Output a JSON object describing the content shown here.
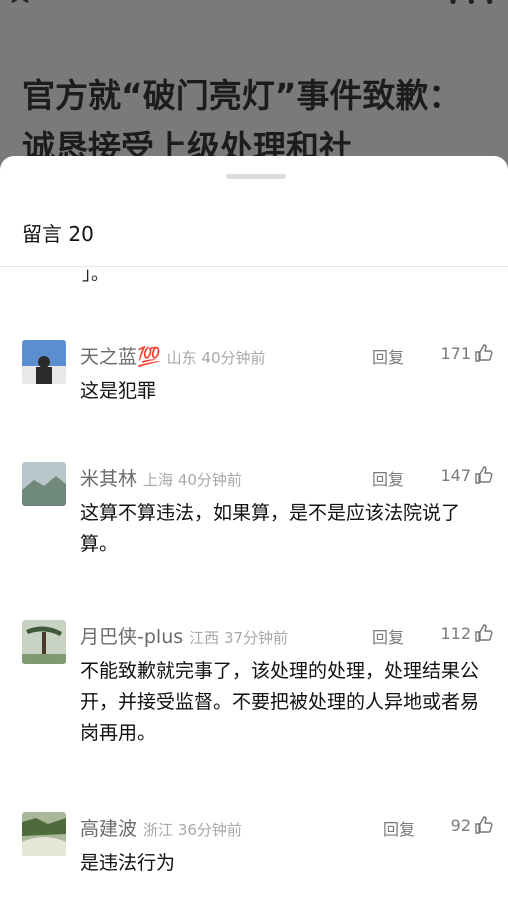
{
  "header": {
    "close_icon": "close-icon",
    "more_icon": "more-icon",
    "more_label": "• • •"
  },
  "article": {
    "title": "官方就“破门亮灯”事件致歉：诚恳接受上级处理和社"
  },
  "sheet": {
    "title": "留言 20",
    "prev_tail": "」。"
  },
  "comments": [
    {
      "name": "天之蓝💯",
      "location": "山东",
      "time": "40分钟前",
      "reply": "回复",
      "likes": "171",
      "text": "这是犯罪"
    },
    {
      "name": "米其林",
      "location": "上海",
      "time": "40分钟前",
      "reply": "回复",
      "likes": "147",
      "text": "这算不算违法，如果算，是不是应该法院说了算。"
    },
    {
      "name": "月巴侠-plus",
      "location": "江西",
      "time": "37分钟前",
      "reply": "回复",
      "likes": "112",
      "text": "不能致歉就完事了，该处理的处理，处理结果公开，并接受监督。不要把被处理的人异地或者易岗再用。"
    },
    {
      "name": "高建波",
      "location": "浙江",
      "time": "36分钟前",
      "reply": "回复",
      "likes": "92",
      "text": "是违法行为"
    }
  ]
}
